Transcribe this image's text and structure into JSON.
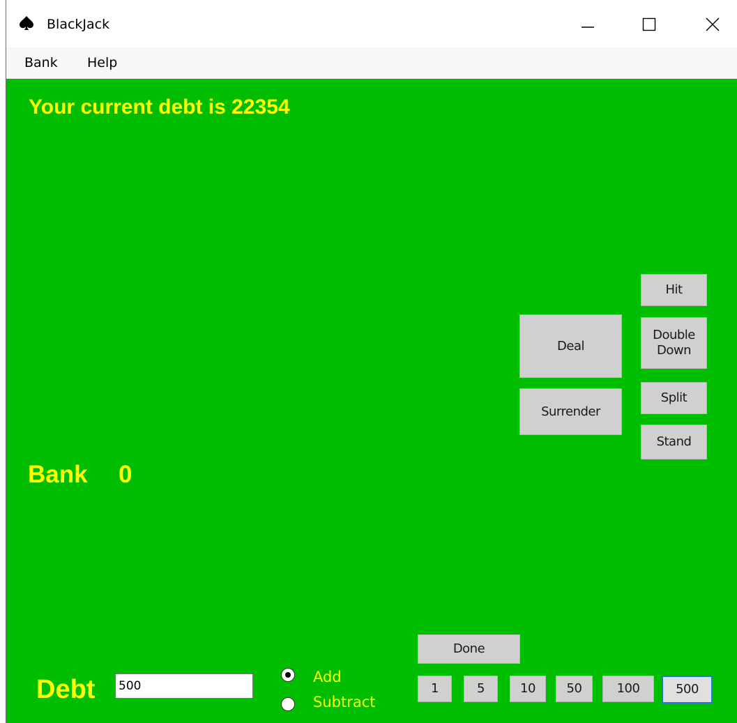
{
  "window": {
    "title": "BlackJack",
    "icon": "spade-icon"
  },
  "menu": {
    "items": [
      {
        "label": "Bank"
      },
      {
        "label": "Help"
      }
    ]
  },
  "table": {
    "debt_message": "Your current debt is 22354",
    "bank_label": "Bank",
    "bank_value": "0"
  },
  "actions": {
    "hit": "Hit",
    "double_down": "Double\nDown",
    "deal": "Deal",
    "split": "Split",
    "surrender": "Surrender",
    "stand": "Stand"
  },
  "debt_panel": {
    "label": "Debt",
    "input_value": "500",
    "mode_options": [
      {
        "label": "Add",
        "selected": true
      },
      {
        "label": "Subtract",
        "selected": false
      }
    ],
    "done": "Done",
    "amounts": [
      "1",
      "5",
      "10",
      "50",
      "100",
      "500"
    ],
    "selected_amount": "500"
  },
  "colors": {
    "felt": "#00bd00",
    "text": "#ffff00",
    "button": "#d0d0d0",
    "selected_border": "#2a72e0"
  }
}
